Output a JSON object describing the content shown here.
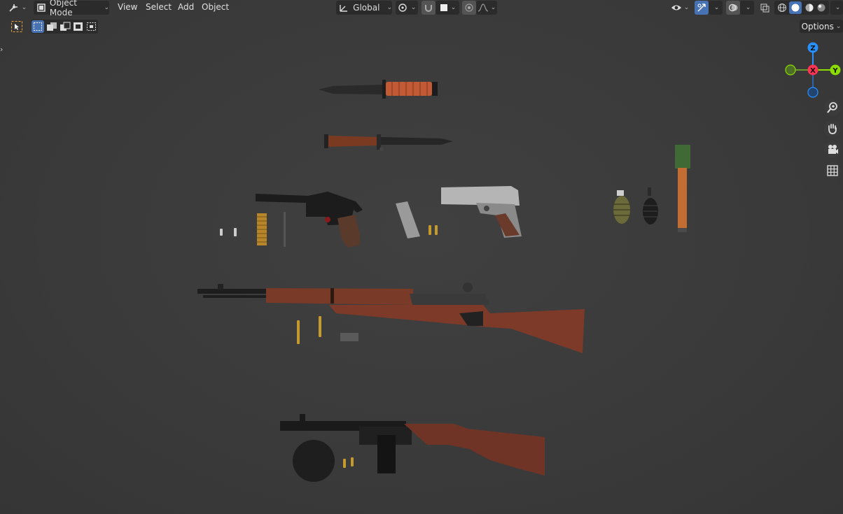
{
  "header": {
    "mode_label": "Object Mode",
    "menus": [
      "View",
      "Select",
      "Add",
      "Object"
    ],
    "transform_orientation": "Global"
  },
  "options_label": "Options",
  "gizmo": {
    "z": "Z",
    "x": "X",
    "y": "Y"
  },
  "icons": {
    "editor_type": "editor-type-icon",
    "object_mode": "object-mode-icon",
    "orientation": "transform-orientation-icon",
    "pivot": "pivot-point-icon",
    "snap": "snap-magnet-icon",
    "proportional": "proportional-editing-icon",
    "visibility": "visibility-eye-icon",
    "gizmo": "gizmo-toggle-icon",
    "overlay": "overlay-icon",
    "xray": "xray-icon",
    "shading": [
      "wireframe-shading-icon",
      "solid-shading-icon",
      "material-shading-icon",
      "rendered-shading-icon"
    ],
    "nav": [
      "zoom-icon",
      "pan-hand-icon",
      "camera-icon",
      "grid-ortho-icon"
    ]
  },
  "colors": {
    "header_bg": "#2b2b2b",
    "active_blue": "#4772b3",
    "axis_x": "#ff3352",
    "axis_y": "#8bdc00",
    "axis_z": "#2890ff"
  }
}
